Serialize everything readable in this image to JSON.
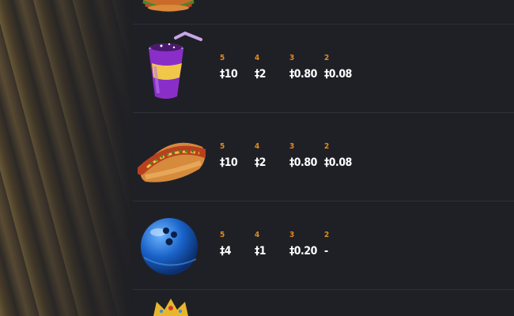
{
  "rows": [
    {
      "symbol_icon": "soda-cup-icon",
      "payouts": [
        {
          "count": "5",
          "amount": "‡10"
        },
        {
          "count": "4",
          "amount": "‡2"
        },
        {
          "count": "3",
          "amount": "‡0.80"
        },
        {
          "count": "2",
          "amount": "‡0.08"
        }
      ]
    },
    {
      "symbol_icon": "hotdog-icon",
      "payouts": [
        {
          "count": "5",
          "amount": "‡10"
        },
        {
          "count": "4",
          "amount": "‡2"
        },
        {
          "count": "3",
          "amount": "‡0.80"
        },
        {
          "count": "2",
          "amount": "‡0.08"
        }
      ]
    },
    {
      "symbol_icon": "bowling-ball-icon",
      "payouts": [
        {
          "count": "5",
          "amount": "‡4"
        },
        {
          "count": "4",
          "amount": "‡1"
        },
        {
          "count": "3",
          "amount": "‡0.20"
        },
        {
          "count": "2",
          "amount": "-"
        }
      ]
    }
  ],
  "partial_icons": [
    "burger-icon",
    "crown-icon"
  ],
  "colors": {
    "count": "#e08a1e",
    "amount": "#ffffff",
    "panel": "#1f2026",
    "divider": "#2e3038"
  }
}
